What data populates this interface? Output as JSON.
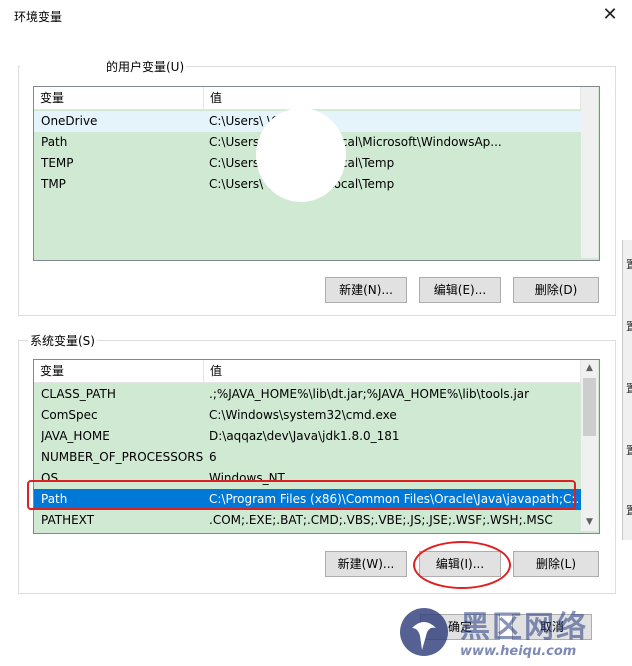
{
  "window": {
    "title": "环境变量",
    "close_glyph": "✕"
  },
  "user_vars": {
    "group_label": "的用户变量(U)",
    "headers": [
      "变量",
      "值"
    ],
    "rows": [
      {
        "name": "OneDrive",
        "value": "C:\\Users\\              \\OneDrive"
      },
      {
        "name": "Path",
        "value": "C:\\Users\\              \\AppData\\Local\\Microsoft\\WindowsAp..."
      },
      {
        "name": "TEMP",
        "value": "C:\\Users\\              \\AppData\\Local\\Temp"
      },
      {
        "name": "TMP",
        "value": "C:\\Users\\              \\AppData\\Local\\Temp"
      }
    ],
    "buttons": {
      "new": "新建(N)...",
      "edit": "编辑(E)...",
      "delete": "删除(D)"
    }
  },
  "sys_vars": {
    "group_label": "系统变量(S)",
    "headers": [
      "变量",
      "值"
    ],
    "rows": [
      {
        "name": "CLASS_PATH",
        "value": ".;%JAVA_HOME%\\lib\\dt.jar;%JAVA_HOME%\\lib\\tools.jar"
      },
      {
        "name": "ComSpec",
        "value": "C:\\Windows\\system32\\cmd.exe"
      },
      {
        "name": "JAVA_HOME",
        "value": "D:\\aqqaz\\dev\\Java\\jdk1.8.0_181"
      },
      {
        "name": "NUMBER_OF_PROCESSORS",
        "value": "6"
      },
      {
        "name": "OS",
        "value": "Windows_NT"
      },
      {
        "name": "Path",
        "value": "C:\\Program Files (x86)\\Common Files\\Oracle\\Java\\javapath;C:..."
      },
      {
        "name": "PATHEXT",
        "value": ".COM;.EXE;.BAT;.CMD;.VBS;.VBE;.JS;.JSE;.WSF;.WSH;.MSC"
      }
    ],
    "selected_index": 5,
    "buttons": {
      "new": "新建(W)...",
      "edit": "编辑(I)...",
      "delete": "删除(L)"
    }
  },
  "footer": {
    "ok": "确定",
    "cancel": "取消"
  },
  "watermark": {
    "brand": "黑区网络",
    "url": "www.heiqu.com"
  },
  "edge_labels": [
    "置",
    "置",
    "置",
    "置",
    "置"
  ],
  "colors": {
    "list_bg": "#cfe9d2",
    "selection": "#0078d7",
    "annotation": "#e02020"
  }
}
